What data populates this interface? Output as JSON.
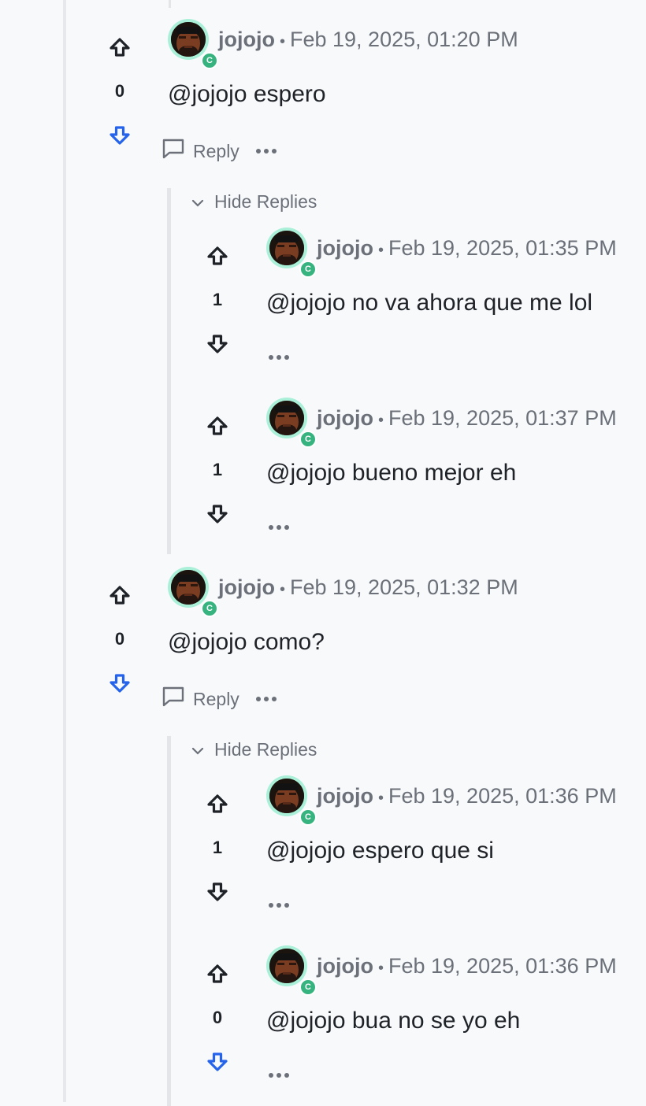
{
  "colors": {
    "vote_up": "#1f2328",
    "vote_down_active": "#2563eb",
    "vote_down_idle": "#1f2328",
    "muted": "#6b7079",
    "avatar_ring": "#aaf0d8",
    "badge": "#36b37e"
  },
  "icons": {
    "upvote": "arrow-up-outline-icon",
    "downvote": "arrow-down-outline-icon",
    "reply": "speech-bubble-icon",
    "more": "ellipsis-icon",
    "collapse": "chevron-down-icon",
    "badge_letter": "C"
  },
  "comments": [
    {
      "author": "jojojo",
      "timestamp": "Feb 19, 2025, 01:20 PM",
      "text": "@jojojo espero",
      "votes": "0",
      "reply_label": "Reply",
      "hide_replies_label": "Hide Replies",
      "replies": [
        {
          "author": "jojojo",
          "timestamp": "Feb 19, 2025, 01:35 PM",
          "text": "@jojojo no va ahora que me lol",
          "votes": "1"
        },
        {
          "author": "jojojo",
          "timestamp": "Feb 19, 2025, 01:37 PM",
          "text": "@jojojo bueno mejor eh",
          "votes": "1"
        }
      ]
    },
    {
      "author": "jojojo",
      "timestamp": "Feb 19, 2025, 01:32 PM",
      "text": "@jojojo como?",
      "votes": "0",
      "reply_label": "Reply",
      "hide_replies_label": "Hide Replies",
      "replies": [
        {
          "author": "jojojo",
          "timestamp": "Feb 19, 2025, 01:36 PM",
          "text": "@jojojo espero que si",
          "votes": "1"
        },
        {
          "author": "jojojo",
          "timestamp": "Feb 19, 2025, 01:36 PM",
          "text": "@jojojo bua no se yo eh",
          "votes": "0"
        }
      ]
    }
  ],
  "separator": "•"
}
